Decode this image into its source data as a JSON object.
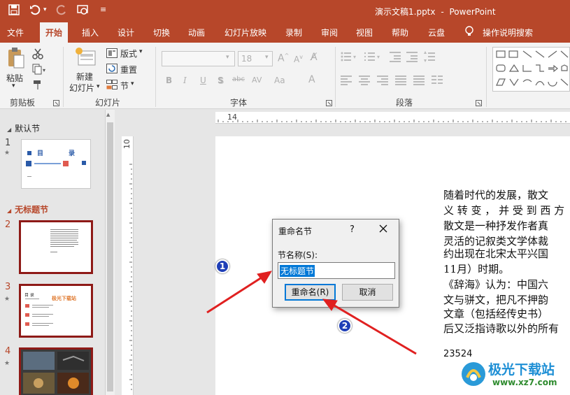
{
  "window": {
    "file_title": "演示文稿1.pptx",
    "separator": "-",
    "app_name": "PowerPoint"
  },
  "tabs": [
    "文件",
    "开始",
    "插入",
    "设计",
    "切换",
    "动画",
    "幻灯片放映",
    "录制",
    "审阅",
    "视图",
    "帮助",
    "云盘",
    "操作说明搜索"
  ],
  "active_tab": "开始",
  "ribbon": {
    "clipboard": {
      "paste": "粘贴",
      "group": "剪贴板"
    },
    "slides": {
      "new_slide_line1": "新建",
      "new_slide_line2": "幻灯片",
      "layout": "版式",
      "reset": "重置",
      "section": "节",
      "group": "幻灯片"
    },
    "font": {
      "size": "18",
      "group": "字体",
      "bold": "B",
      "italic": "I",
      "underline": "U",
      "shadow": "S",
      "strike": "abc",
      "spacing": "AV",
      "case": "Aa",
      "color": "A"
    },
    "paragraph": {
      "group": "段落"
    }
  },
  "thumbnails": {
    "section_default": "默认节",
    "section_untitled": "无标题节",
    "slides": [
      {
        "number": "1",
        "title_a": "目",
        "title_b": "录"
      },
      {
        "number": "2"
      },
      {
        "number": "3",
        "label": "目 录",
        "title": "极光下载站"
      },
      {
        "number": "4"
      }
    ]
  },
  "ruler": {
    "h_label": "14",
    "v_label": "10"
  },
  "slide_text": {
    "lines": [
      "随着时代的发展，散文",
      "义 转 变 ， 并 受 到 西 方",
      "散文是一种抒发作者真",
      "灵活的记叙类文学体裁",
      "约出现在北宋太平兴国",
      "11月）时期。",
      "《辞海》认为：中国六",
      "文与骈文，把凡不押韵",
      "文章（包括经传史书）",
      "后又泛指诗歌以外的所有"
    ],
    "number": "23524"
  },
  "dialog": {
    "title": "重命名节",
    "help": "?",
    "label": "节名称(S):",
    "input_value": "无标题节",
    "rename_button": "重命名(R)",
    "cancel_button": "取消"
  },
  "annotations": {
    "badge1": "1",
    "badge2": "2",
    "arrow_color": "#e02020"
  },
  "watermark": {
    "name": "极光下载站",
    "url": "www.xz7.com"
  },
  "colors": {
    "accent": "#b7472a",
    "selection": "#0078d7",
    "thumb_selected_border": "#8e1a17"
  }
}
